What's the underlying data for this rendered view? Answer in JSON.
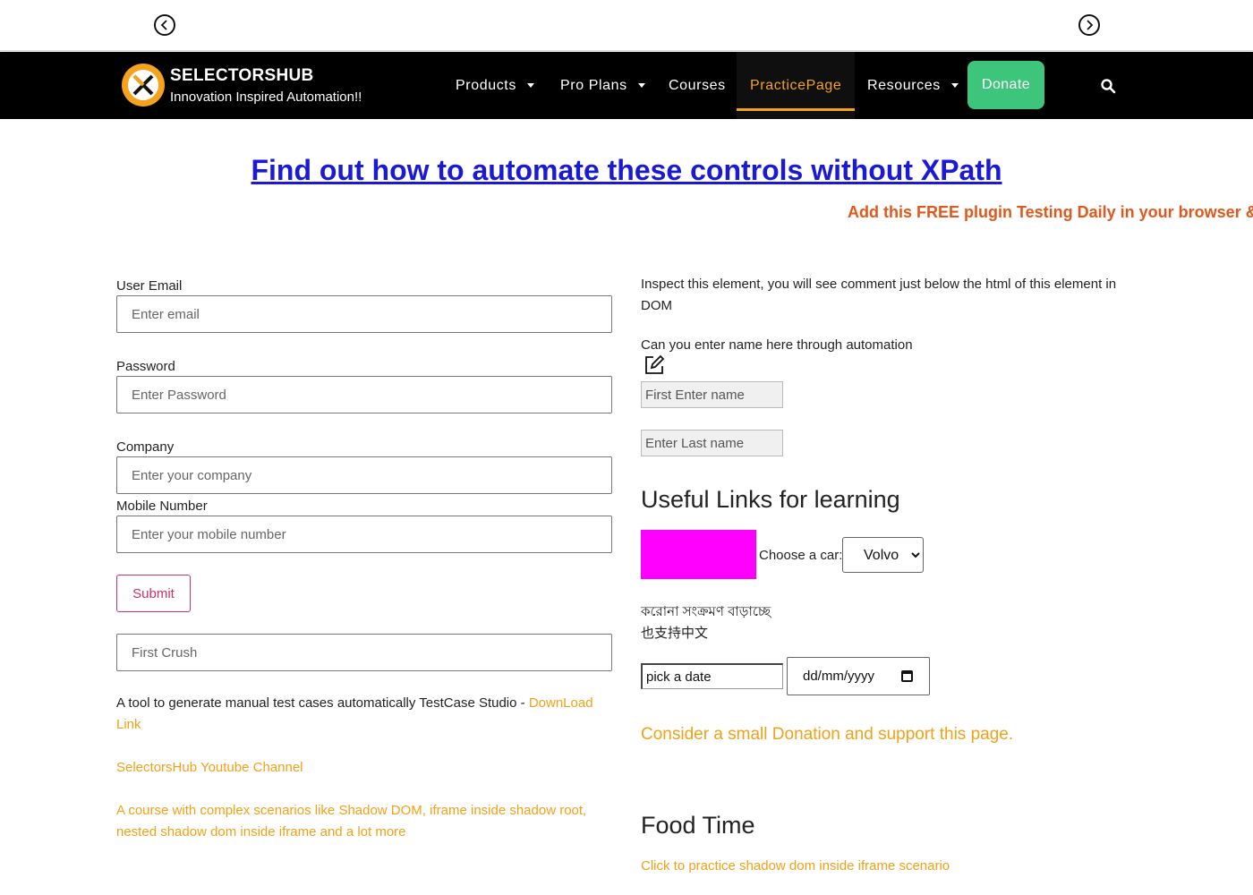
{
  "topbar": {
    "prev_icon": "chevron-left-circle-icon",
    "next_icon": "chevron-right-circle-icon"
  },
  "navbar": {
    "brand_name": "SELECTORSHUB",
    "brand_tagline": "Innovation Inspired Automation!!",
    "items": [
      {
        "label": "Products",
        "dropdown": true
      },
      {
        "label": "Pro Plans",
        "dropdown": true
      },
      {
        "label": "Courses",
        "dropdown": false
      },
      {
        "label": "PracticePage",
        "dropdown": false,
        "active": true
      },
      {
        "label": "Resources",
        "dropdown": true
      }
    ],
    "donate_label": "Donate",
    "search_icon": "search-icon"
  },
  "headline": "Find out how to automate these controls without XPath",
  "marquee": "Add this FREE plugin Testing Daily in your browser & k",
  "form": {
    "email_label": "User Email",
    "email_placeholder": "Enter email",
    "password_label": "Password",
    "password_placeholder": "Enter Password",
    "company_label": "Company",
    "company_placeholder": "Enter your company",
    "mobile_label": "Mobile Number",
    "mobile_placeholder": "Enter your mobile number",
    "submit_label": "Submit",
    "crush_placeholder": "First Crush"
  },
  "left_text": {
    "tool_text": "A tool to generate manual test cases automatically TestCase Studio - ",
    "tool_link": "DownLoad Link",
    "youtube_link": "SelectorsHub Youtube Channel",
    "course_link": "A course with complex scenarios like Shadow DOM, iframe inside shadow root, nested shadow dom inside iframe and a lot more"
  },
  "right": {
    "inspect_text": "Inspect this element, you will see comment just below the html of this element in DOM",
    "automation_text": "Can you enter name here through automation",
    "edit_icon": "edit-icon",
    "first_name_placeholder": "First Enter name",
    "last_name_placeholder": "Enter Last name",
    "useful_links_heading": "Useful Links for learning",
    "car_label": "Choose a car:",
    "car_selected": "Volvo",
    "bengali_text": "করোনা সংক্রমণ বাড়াচ্ছে",
    "chinese_text": "也支持中文",
    "pick_date_value": "pick a date",
    "date_placeholder": "dd/mm/yyyy",
    "donation_link": "Consider a small Donation and support this page.",
    "food_heading": "Food Time",
    "shadow_link": "Click to practice shadow dom inside iframe scenario"
  },
  "colors": {
    "navbar_bg": "#000000",
    "active_nav": "#f4a31a",
    "donate_bg": "#3ec57c",
    "headline": "#1a1ad6",
    "marquee": "#e2571a",
    "link_orange": "#f0a11a",
    "magenta_box": "#ff00ff",
    "submit_border": "#c6346b"
  }
}
